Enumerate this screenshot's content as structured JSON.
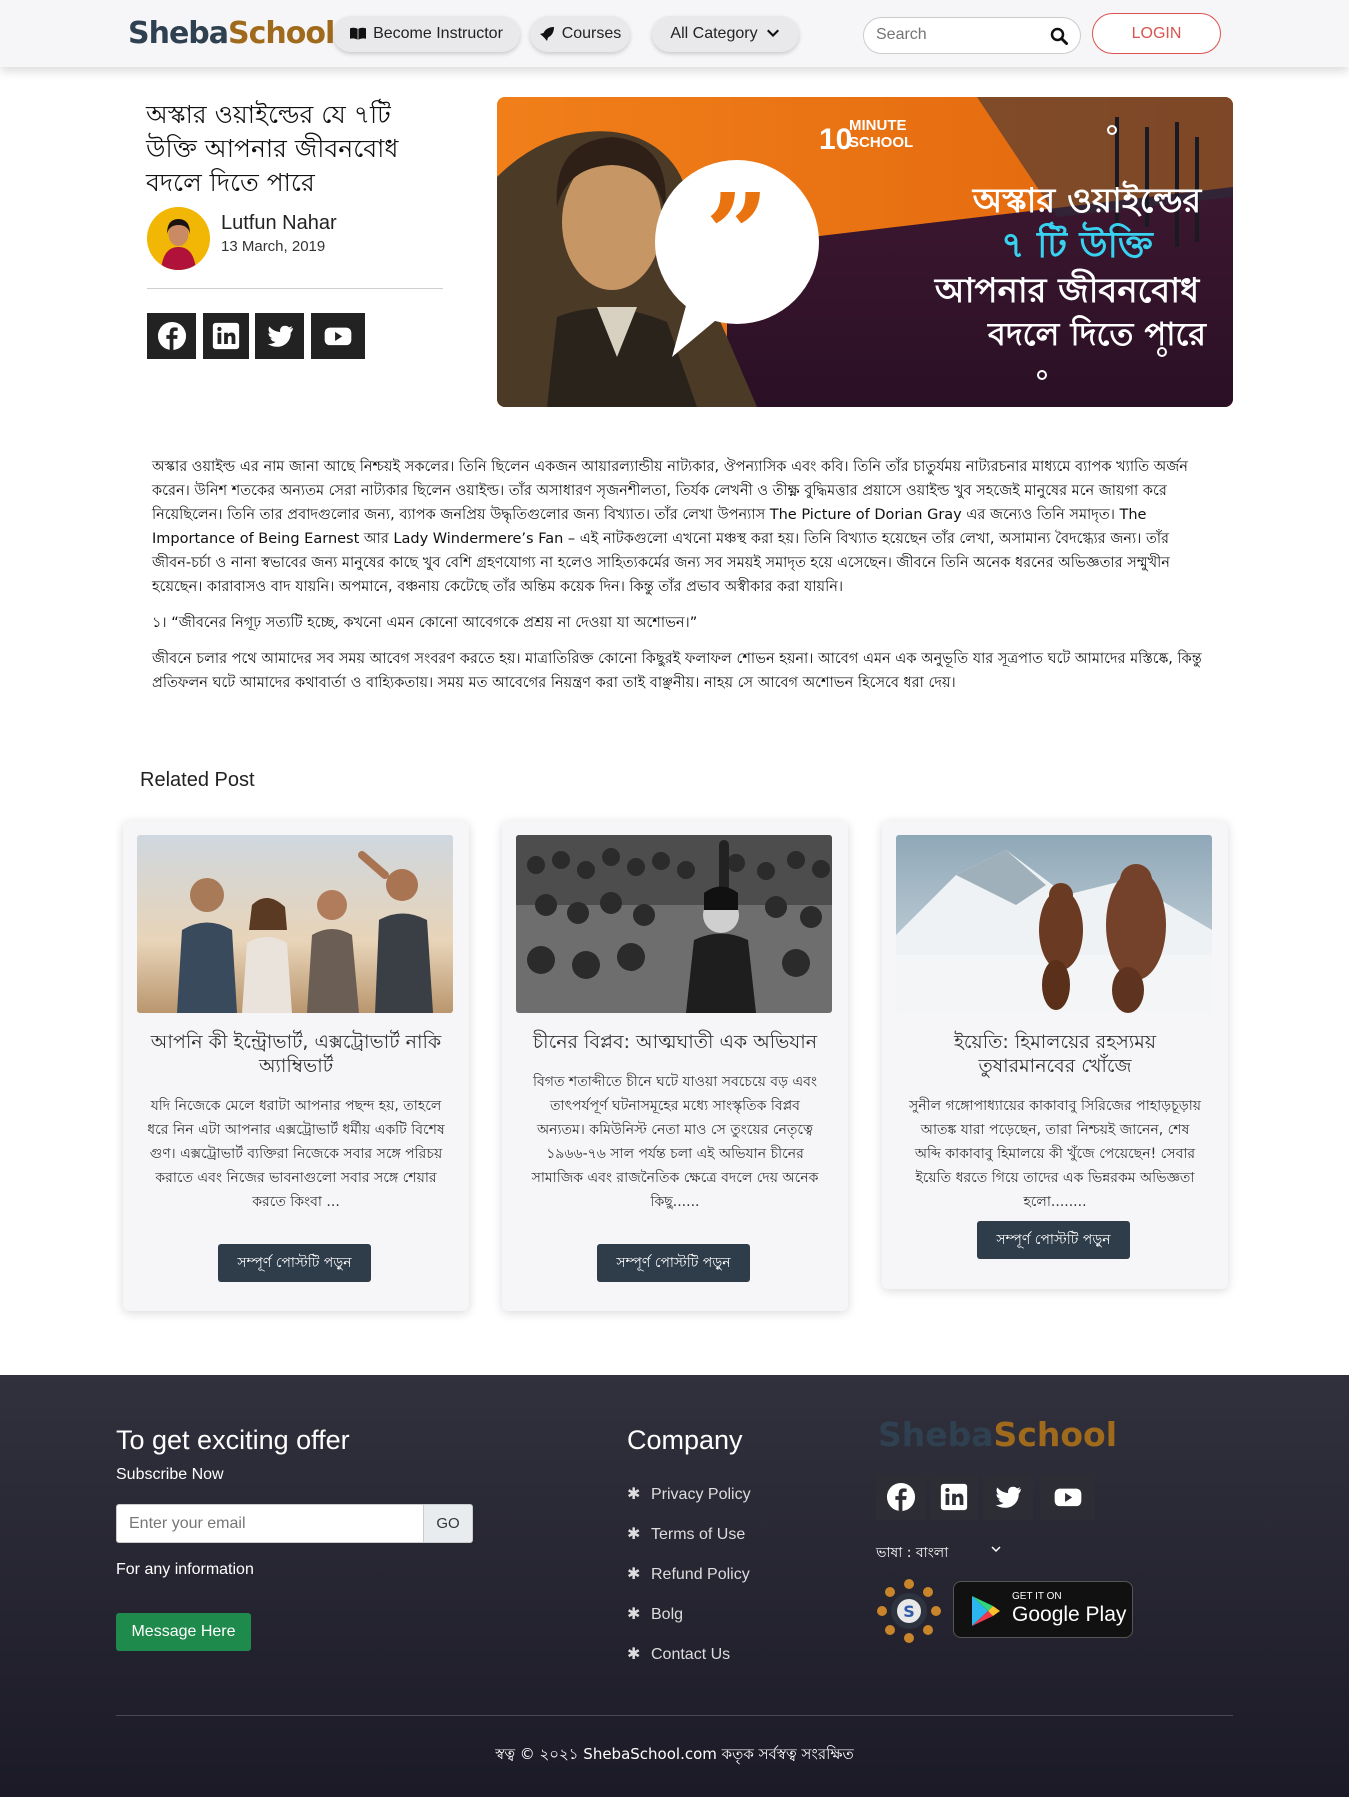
{
  "nav": {
    "logo_part1": "Sheba",
    "logo_part2": "School",
    "become_instructor": "Become Instructor",
    "courses": "Courses",
    "all_category": "All Category",
    "search_placeholder": "Search",
    "login": "LOGIN"
  },
  "post": {
    "title": "অস্কার ওয়াইল্ডের যে ৭টি উক্তি আপনার জীবনবোধ বদলে দিতে পারে",
    "author": "Lutfun Nahar",
    "date": "13 March, 2019",
    "hero": {
      "brand_num": "10",
      "brand_line1": "MINUTE",
      "brand_line2": "SCHOOL",
      "line1": "অস্কার ওয়াইল্ডের",
      "line2": "৭ টি উক্তি",
      "line3": "আপনার জীবনবোধ",
      "line4": "বদলে দিতে পারে"
    },
    "paragraphs": [
      "অস্কার ওয়াইল্ড এর নাম জানা আছে নিশ্চয়ই সকলের। তিনি ছিলেন একজন আয়ারল্যান্ডীয় নাট্যকার, ঔপন্যাসিক এবং কবি। তিনি তাঁর চাতুর্যময় নাট্যরচনার মাধ্যমে ব্যাপক খ্যাতি অর্জন করেন। উনিশ শতকের অন্যতম সেরা নাট্যকার ছিলেন ওয়াইল্ড। তাঁর অসাধারণ সৃজনশীলতা, তির্যক লেখনী ও তীক্ষ্ণ বুদ্ধিমত্তার প্রয়াসে ওয়াইল্ড খুব সহজেই মানুষের মনে জায়গা করে নিয়েছিলেন। তিনি তার প্রবাদগুলোর জন্য, ব্যাপক জনপ্রিয় উদ্ধৃতিগুলোর জন্য বিখ্যাত। তাঁর লেখা উপন্যাস The Picture of Dorian Gray এর জন্যেও তিনি সমাদৃত। The Importance of Being Earnest আর Lady Windermere’s Fan – এই নাটকগুলো এখনো মঞ্চস্থ করা হয়। তিনি বিখ্যাত হয়েছেন তাঁর লেখা, অসামান্য বৈদগ্ধ্যের জন্য। তাঁর জীবন-চর্চা ও নানা স্বভাবের জন্য মানুষের কাছে খুব বেশি গ্রহণযোগ্য না হলেও সাহিত্যকর্মের জন্য সব সময়ই সমাদৃত হয়ে এসেছেন। জীবনে তিনি অনেক ধরনের অভিজ্ঞতার সম্মুখীন হয়েছেন। কারাবাসও বাদ যায়নি। অপমানে, বঞ্চনায় কেটেছে তাঁর অন্তিম কয়েক দিন। কিন্তু তাঁর প্রভাব অস্বীকার করা যায়নি।",
      "১। “জীবনের নিগূঢ় সত্যটি হচ্ছে, কখনো এমন কোনো আবেগকে প্রশ্রয় না দেওয়া যা অশোভন।”",
      "জীবনে চলার পথে আমাদের সব সময় আবেগ সংবরণ করতে হয়। মাত্রাতিরিক্ত কোনো কিছুরই ফলাফল শোভন হয়না। আবেগ এমন এক অনুভূতি যার সূত্রপাত ঘটে আমাদের মস্তিষ্কে, কিন্তু প্রতিফলন ঘটে আমাদের কথাবার্তা ও বাহ্যিকতায়। সময় মত আবেগের নিয়ন্ত্রণ করা তাই বাঞ্ছনীয়। নাহয় সে আবেগ অশোভন হিসেবে ধরা দেয়।"
    ]
  },
  "related": {
    "heading": "Related Post",
    "posts": [
      {
        "title": "আপনি কী ইন্ট্রোভার্ট, এক্সট্রোভার্ট নাকি অ্যাম্বিভার্ট",
        "excerpt": "যদি নিজেকে মেলে ধরাটা আপনার পছন্দ হয়, তাহলে ধরে নিন এটা আপনার এক্সট্রোভার্ট ধর্মীয় একটি বিশেষ গুণ। এক্সট্রোভার্ট ব্যক্তিরা নিজেকে সবার সঙ্গে পরিচয় করাতে এবং নিজের ভাবনাগুলো সবার সঙ্গে শেয়ার করতে কিংবা ...",
        "button": "সম্পূর্ণ পোস্টটি পড়ুন"
      },
      {
        "title": "চীনের বিপ্লব: আত্মঘাতী এক অভিযান",
        "excerpt": "বিগত শতাব্দীতে চীনে ঘটে যাওয়া সবচেয়ে বড় এবং তাৎপর্যপূর্ণ ঘটনাসমূহের মধ্যে সাংস্কৃতিক বিপ্লব অন্যতম। কমিউনিস্ট নেতা মাও সে তুংয়ের নেতৃত্বে ১৯৬৬-৭৬ সাল পর্যন্ত চলা এই অভিযান চীনের সামাজিক এবং রাজনৈতিক ক্ষেত্রে বদলে দেয় অনেক কিছু......",
        "button": "সম্পূর্ণ পোস্টটি পড়ুন"
      },
      {
        "title": "ইয়েতি: হিমালয়ের রহস্যময় তুষারমানবের খোঁজে",
        "excerpt": "সুনীল গঙ্গোপাধ্যায়ের কাকাবাবু সিরিজের পাহাড়চূড়ায় আতঙ্ক যারা পড়েছেন, তারা নিশ্চয়ই জানেন, শেষ অব্দি কাকাবাবু হিমালয়ে কী খুঁজে পেয়েছেন! সেবার ইয়েতি ধরতে গিয়ে তাদের এক ভিন্নরকম অভিজ্ঞতা হলো........",
        "button": "সম্পূর্ণ পোস্টটি পড়ুন"
      }
    ]
  },
  "footer": {
    "offer_heading": "To get exciting offer",
    "subscribe": "Subscribe Now",
    "email_placeholder": "Enter your email",
    "go": "GO",
    "info": "For any information",
    "message_btn": "Message Here",
    "company_heading": "Company",
    "links": [
      "Privacy Policy",
      "Terms of Use",
      "Refund Policy",
      "Bolg",
      "Contact Us"
    ],
    "logo_part1": "Sheba",
    "logo_part2": "School",
    "language": "ভাষা : বাংলা",
    "gplay_small": "GET IT ON",
    "gplay_big": "Google Play",
    "copyright": "স্বত্ব © ২০২১ ShebaSchool.com কতৃক সর্বস্বত্ব সংরক্ষিত"
  },
  "colors": {
    "accent_red": "#d9534f",
    "card_button": "#2f3d4b",
    "message_button": "#1e8a4c",
    "hero_orange": "#e9730f"
  }
}
